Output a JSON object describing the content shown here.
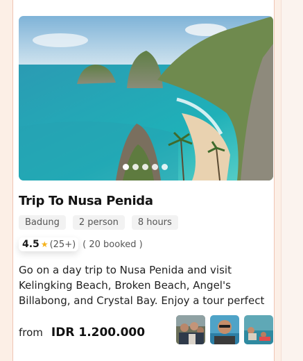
{
  "trip": {
    "title": "Trip To Nusa Penida",
    "tags": [
      "Badung",
      "2 person",
      "8 hours"
    ],
    "rating": "4.5",
    "reviews": "(25+)",
    "booked": "( 20 booked )",
    "description": "Go on a day trip to Nusa Penida and visit Kelingking Beach, Broken Beach, Angel's Billabong, and Crystal Bay. Enjoy a tour perfect",
    "price_prefix": "from",
    "price": "IDR 1.200.000"
  },
  "carousel": {
    "slides": 5,
    "active_index": 0
  },
  "gallery": [
    "group-selfie-photo",
    "man-sunglasses-photo",
    "boat-sea-photo"
  ],
  "colors": {
    "accent_star": "#f5b21b",
    "border": "#f0c4b4",
    "page_bg": "#fcefe6"
  }
}
